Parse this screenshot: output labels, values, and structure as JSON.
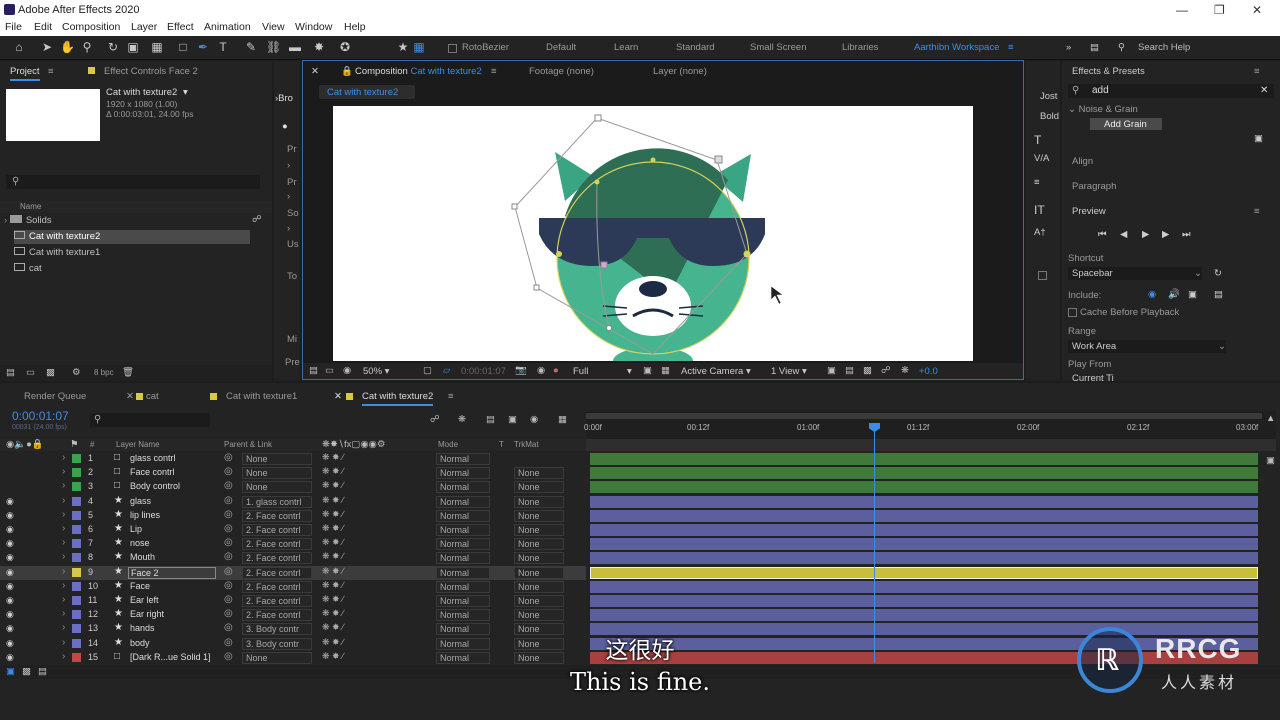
{
  "app": {
    "title": "Adobe After Effects 2020"
  },
  "menu": [
    "File",
    "Edit",
    "Composition",
    "Layer",
    "Effect",
    "Animation",
    "View",
    "Window",
    "Help"
  ],
  "toolbar": {
    "rotobezier": "RotoBezier",
    "workspaces": [
      "Default",
      "Learn",
      "Standard",
      "Small Screen",
      "Libraries"
    ],
    "active_workspace": "Aarthibn Workspace",
    "search_help": "Search Help"
  },
  "project": {
    "tab": "Project",
    "effect_controls_tab": "Effect Controls Face 2",
    "selected_name": "Cat with texture2",
    "selected_info1": "1920 x 1080 (1.00)",
    "selected_info2": "Δ 0:00:03:01, 24.00 fps",
    "col_name": "Name",
    "items": [
      "Solids",
      "Cat with texture2",
      "Cat with texture1",
      "cat"
    ],
    "bpc": "8 bpc"
  },
  "char_frag": {
    "tab": "Bro",
    "f1": "Pr",
    "f2": "Pr",
    "f3": "So",
    "f4": "Us",
    "f5": "To",
    "f6": "Mi",
    "f7": "Pre"
  },
  "viewer": {
    "comp_tab_prefix": "Composition",
    "comp_tab_name": "Cat with texture2",
    "footage_tab": "Footage (none)",
    "layer_tab": "Layer (none)",
    "crumb": "Cat with texture2",
    "zoom": "50%",
    "timecode": "0:00:01:07",
    "resolution": "Full",
    "camera": "Active Camera",
    "views": "1 View",
    "exposure": "+0.0"
  },
  "right_frag": {
    "jost": "Jost",
    "bold": "Bold"
  },
  "effects": {
    "tab": "Effects & Presets",
    "search": "add",
    "category": "Noise & Grain",
    "item": "Add Grain",
    "align": "Align",
    "paragraph": "Paragraph",
    "preview": "Preview",
    "shortcut_label": "Shortcut",
    "shortcut_value": "Spacebar",
    "include": "Include:",
    "cache": "Cache Before Playback",
    "range_label": "Range",
    "range_value": "Work Area",
    "play_from": "Play From",
    "cut_text": "Current Ti"
  },
  "timeline": {
    "tabs": [
      "Render Queue",
      "cat",
      "Cat with texture1",
      "Cat with texture2"
    ],
    "timecode": "0:00:01:07",
    "fps": "00031 (24.00 fps)",
    "col_layer": "Layer Name",
    "col_parent": "Parent & Link",
    "col_mode": "Mode",
    "col_t": "T",
    "col_trkmat": "TrkMat",
    "ruler": [
      "0:00f",
      "00:12f",
      "01:00f",
      "01:12f",
      "02:00f",
      "02:12f",
      "03:00f"
    ],
    "layers": [
      {
        "num": "1",
        "name": "glass contrl",
        "parent": "None",
        "mode": "Normal",
        "trk": "",
        "color": "#3aa350",
        "bar": "#3f7a3a",
        "eye": false,
        "star": false
      },
      {
        "num": "2",
        "name": "Face contrl",
        "parent": "None",
        "mode": "Normal",
        "trk": "None",
        "color": "#3aa350",
        "bar": "#3f7a3a",
        "eye": false,
        "star": false
      },
      {
        "num": "3",
        "name": "Body control",
        "parent": "None",
        "mode": "Normal",
        "trk": "None",
        "color": "#3aa350",
        "bar": "#3f7a3a",
        "eye": false,
        "star": false
      },
      {
        "num": "4",
        "name": "glass",
        "parent": "1. glass contrl",
        "mode": "Normal",
        "trk": "None",
        "color": "#6b6fc4",
        "bar": "#5b5f9e",
        "eye": true,
        "star": true
      },
      {
        "num": "5",
        "name": "lip lines",
        "parent": "2. Face contrl",
        "mode": "Normal",
        "trk": "None",
        "color": "#6b6fc4",
        "bar": "#5b5f9e",
        "eye": true,
        "star": true
      },
      {
        "num": "6",
        "name": "Lip",
        "parent": "2. Face contrl",
        "mode": "Normal",
        "trk": "None",
        "color": "#6b6fc4",
        "bar": "#5b5f9e",
        "eye": true,
        "star": true
      },
      {
        "num": "7",
        "name": "nose",
        "parent": "2. Face contrl",
        "mode": "Normal",
        "trk": "None",
        "color": "#6b6fc4",
        "bar": "#5b5f9e",
        "eye": true,
        "star": true
      },
      {
        "num": "8",
        "name": "Mouth",
        "parent": "2. Face contrl",
        "mode": "Normal",
        "trk": "None",
        "color": "#6b6fc4",
        "bar": "#5b5f9e",
        "eye": true,
        "star": true
      },
      {
        "num": "9",
        "name": "Face 2",
        "parent": "2. Face contrl",
        "mode": "Normal",
        "trk": "None",
        "color": "#d8c84a",
        "bar": "#c9be3a",
        "eye": true,
        "star": true,
        "selected": true
      },
      {
        "num": "10",
        "name": "Face",
        "parent": "2. Face contrl",
        "mode": "Normal",
        "trk": "None",
        "color": "#6b6fc4",
        "bar": "#5b5f9e",
        "eye": true,
        "star": true
      },
      {
        "num": "11",
        "name": "Ear left",
        "parent": "2. Face contrl",
        "mode": "Normal",
        "trk": "None",
        "color": "#6b6fc4",
        "bar": "#5b5f9e",
        "eye": true,
        "star": true
      },
      {
        "num": "12",
        "name": "Ear right",
        "parent": "2. Face contrl",
        "mode": "Normal",
        "trk": "None",
        "color": "#6b6fc4",
        "bar": "#5b5f9e",
        "eye": true,
        "star": true
      },
      {
        "num": "13",
        "name": "hands",
        "parent": "3. Body contr",
        "mode": "Normal",
        "trk": "None",
        "color": "#6b6fc4",
        "bar": "#5b5f9e",
        "eye": true,
        "star": true
      },
      {
        "num": "14",
        "name": "body",
        "parent": "3. Body contr",
        "mode": "Normal",
        "trk": "None",
        "color": "#6b6fc4",
        "bar": "#5b5f9e",
        "eye": true,
        "star": true
      },
      {
        "num": "15",
        "name": "[Dark R...ue Solid 1]",
        "parent": "None",
        "mode": "Normal",
        "trk": "None",
        "color": "#c04848",
        "bar": "#a84040",
        "eye": true,
        "star": false
      }
    ]
  },
  "subtitle": {
    "cn": "这很好",
    "en": "This is fine."
  },
  "logo": {
    "text": "RRCG",
    "sub": "人人素材"
  }
}
